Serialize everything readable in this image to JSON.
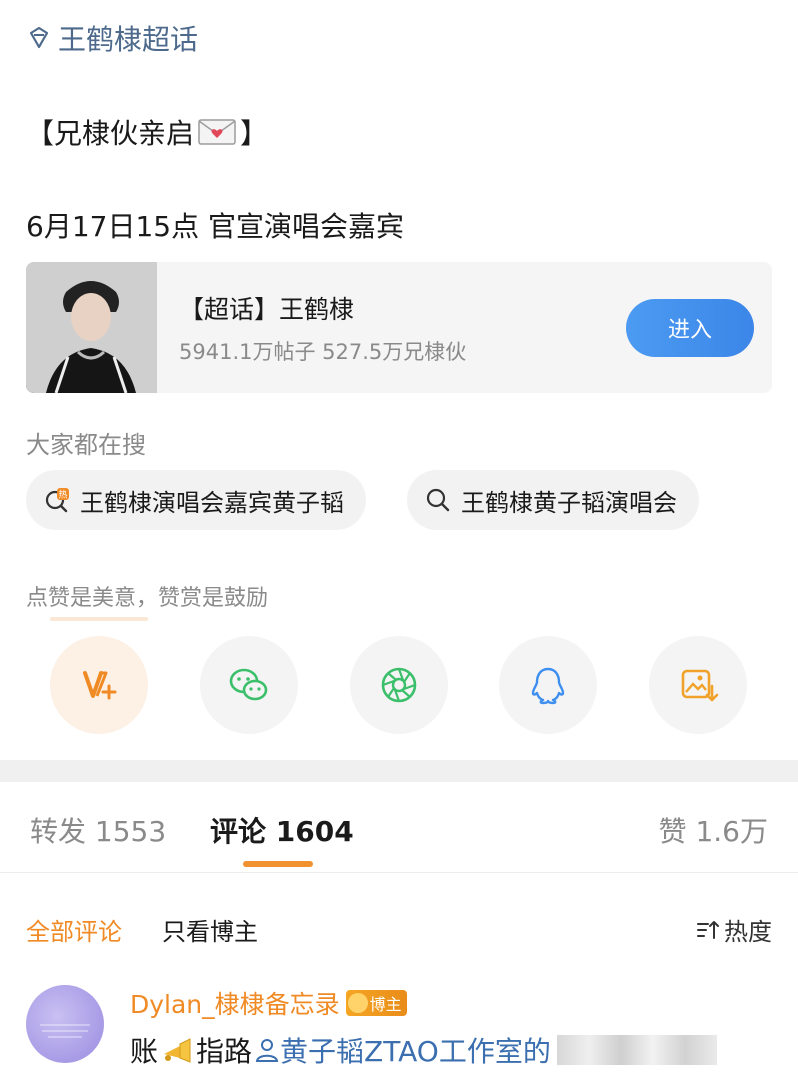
{
  "topic_header": "王鹤棣超话",
  "post": {
    "title_prefix": "【兄棣伙亲启",
    "title_suffix": "】",
    "line": "6月17日15点 官宣演唱会嘉宾"
  },
  "topic_card": {
    "name": "【超话】王鹤棣",
    "stats": "5941.1万帖子 527.5万兄棣伙",
    "enter_label": "进入"
  },
  "search": {
    "title": "大家都在搜",
    "chips": [
      {
        "label": "王鹤棣演唱会嘉宾黄子韬",
        "icon": "hot-search-icon"
      },
      {
        "label": "王鹤棣黄子韬演唱会",
        "icon": "search-icon"
      }
    ]
  },
  "reward": {
    "title": "点赞是美意，赞赏是鼓励",
    "actions": [
      "reward-v-icon",
      "wechat-icon",
      "moments-icon",
      "qq-icon",
      "save-image-icon"
    ]
  },
  "tabs": {
    "repost": "转发 1553",
    "comment": "评论 1604",
    "like": "赞 1.6万"
  },
  "filters": {
    "all": "全部评论",
    "owner_only": "只看博主",
    "sort": "热度"
  },
  "comment": {
    "user": "Dylan_棣棣备忘录",
    "badge": "博主",
    "text_a": "账",
    "text_b": "指路",
    "link": "黄子韬ZTAO工作室的"
  },
  "colors": {
    "accent_orange": "#f08a24",
    "link_blue": "#3b6fb0",
    "enter_blue": "#3b86e8"
  }
}
